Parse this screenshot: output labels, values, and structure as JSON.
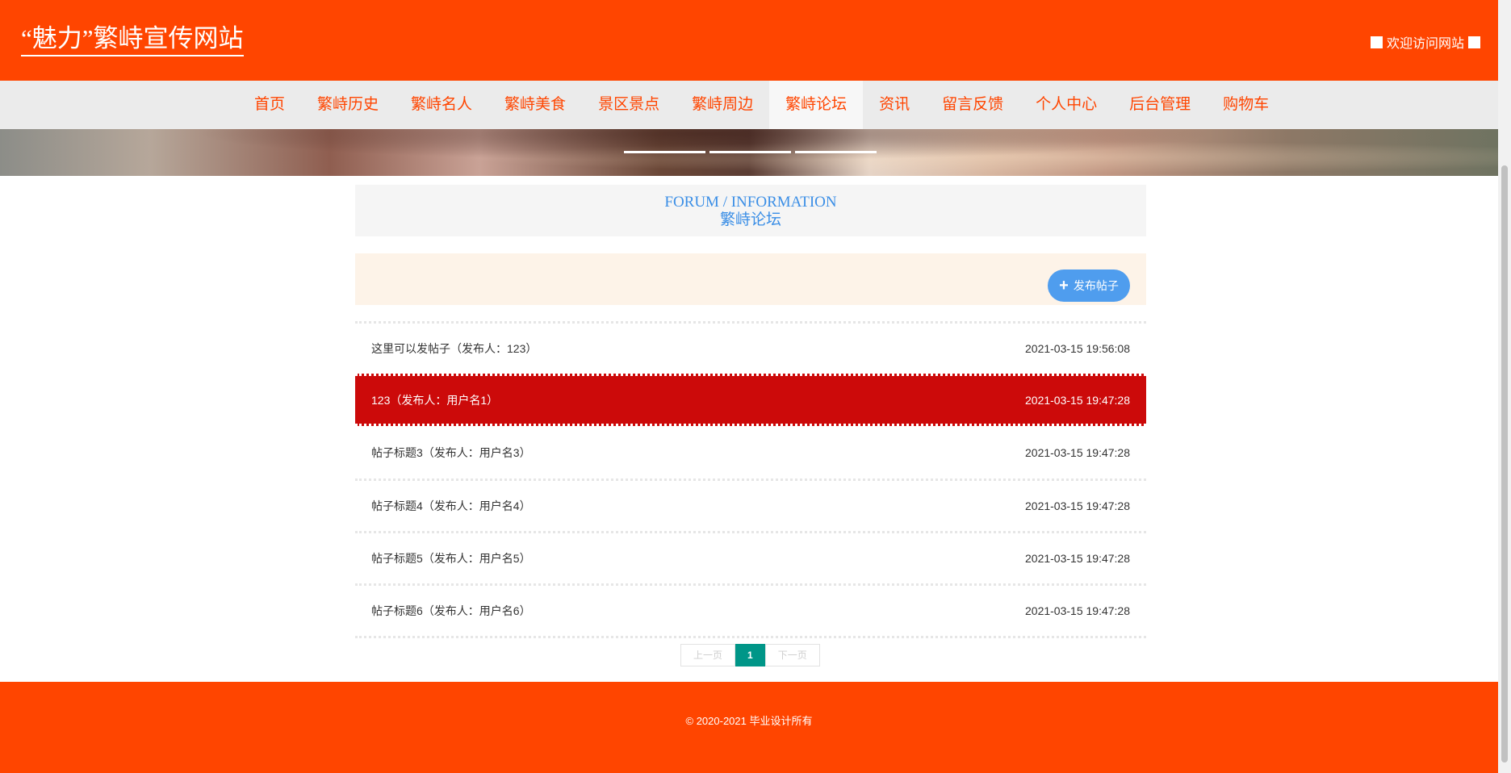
{
  "header": {
    "site_title": "“魅力”繁峙宣传网站",
    "welcome": "欢迎访问网站"
  },
  "nav": {
    "items": [
      "首页",
      "繁峙历史",
      "繁峙名人",
      "繁峙美食",
      "景区景点",
      "繁峙周边",
      "繁峙论坛",
      "资讯",
      "留言反馈",
      "个人中心",
      "后台管理",
      "购物车"
    ],
    "active": "繁峙论坛"
  },
  "section": {
    "title_en": "FORUM / INFORMATION",
    "title_cn": "繁峙论坛"
  },
  "actions": {
    "post_button": "发布帖子",
    "plus_icon": "plus-icon"
  },
  "posts": [
    {
      "title": "这里可以发帖子（发布人：123）",
      "time": "2021-03-15 19:56:08"
    },
    {
      "title": "123（发布人：用户名1）",
      "time": "2021-03-15 19:47:28"
    },
    {
      "title": "帖子标题3（发布人：用户名3）",
      "time": "2021-03-15 19:47:28"
    },
    {
      "title": "帖子标题4（发布人：用户名4）",
      "time": "2021-03-15 19:47:28"
    },
    {
      "title": "帖子标题5（发布人：用户名5）",
      "time": "2021-03-15 19:47:28"
    },
    {
      "title": "帖子标题6（发布人：用户名6）",
      "time": "2021-03-15 19:47:28"
    }
  ],
  "pagination": {
    "prev": "上一页",
    "current": "1",
    "next": "下一页"
  },
  "footer": {
    "copyright": "© 2020-2021 毕业设计所有"
  },
  "colors": {
    "brand": "#ff4500",
    "highlight_row": "#cc0a0a",
    "accent_blue": "#3a8ee6",
    "page_current": "#009688"
  }
}
